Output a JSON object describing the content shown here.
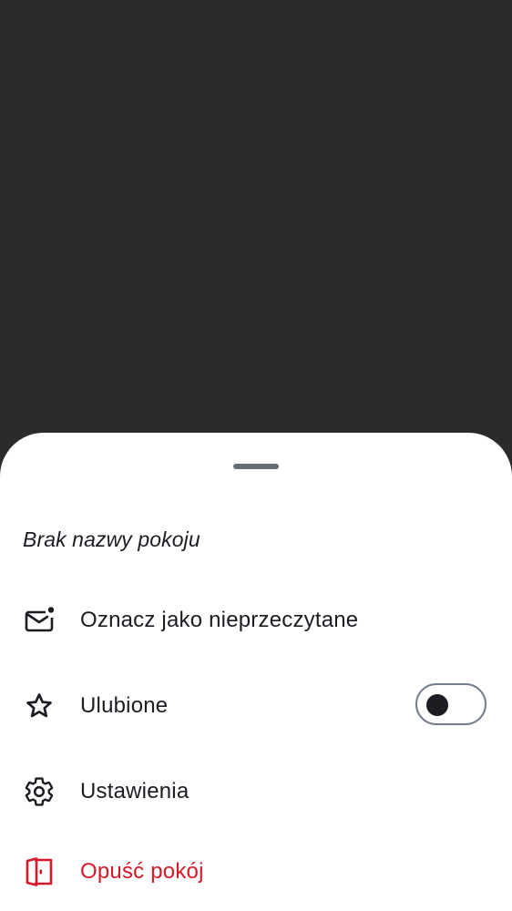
{
  "sheet": {
    "title": "Brak nazwy pokoju",
    "items": [
      {
        "label": "Oznacz jako nieprzeczytane",
        "icon": "mark-unread-icon"
      },
      {
        "label": "Ulubione",
        "icon": "star-icon",
        "toggle": {
          "checked": false
        }
      },
      {
        "label": "Ustawienia",
        "icon": "gear-icon"
      },
      {
        "label": "Opuść pokój",
        "icon": "leave-door-icon",
        "color": "#d51928"
      }
    ]
  },
  "colors": {
    "scrim": "#2a2b2d",
    "sheet": "#ffffff",
    "text": "#1b1d22",
    "danger": "#d51928",
    "handle": "#656d77"
  }
}
